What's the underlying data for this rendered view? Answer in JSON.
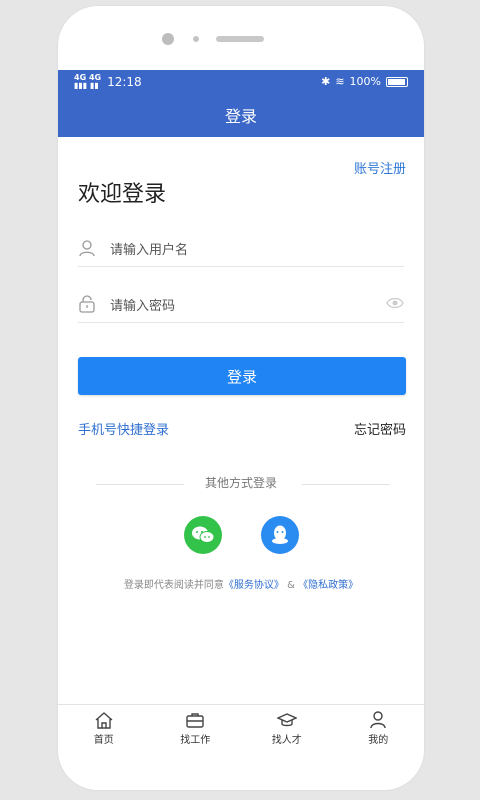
{
  "status": {
    "network": "4G",
    "network2": "4G",
    "time": "12:18",
    "battery": "100%"
  },
  "header": {
    "title": "登录"
  },
  "links": {
    "register": "账号注册"
  },
  "welcome": "欢迎登录",
  "fields": {
    "username_placeholder": "请输入用户名",
    "password_placeholder": "请输入密码"
  },
  "buttons": {
    "login": "登录",
    "phone_login": "手机号快捷登录",
    "forgot": "忘记密码"
  },
  "other_login": {
    "label": "其他方式登录",
    "options": [
      "wechat-icon",
      "qq-icon"
    ]
  },
  "agreement": {
    "prefix": "登录即代表阅读并同意",
    "service": "《服务协议》",
    "and": "&",
    "privacy": "《隐私政策》"
  },
  "tabbar": {
    "items": [
      "首页",
      "找工作",
      "找人才",
      "我的"
    ]
  },
  "colors": {
    "primary": "#3a67c8",
    "button": "#2084f5",
    "wechat": "#33c24a",
    "qq": "#2a8cf0"
  }
}
